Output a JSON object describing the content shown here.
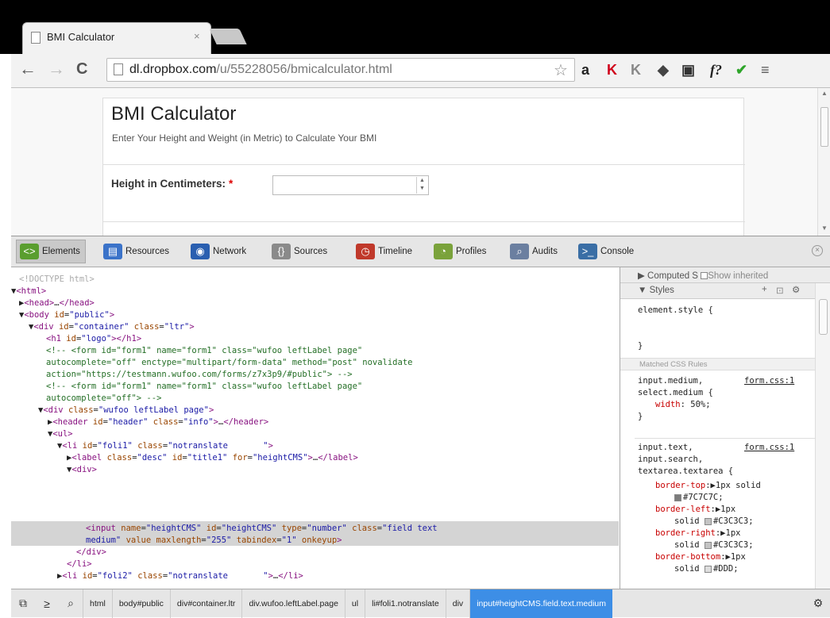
{
  "browser": {
    "tab_title": "BMI Calculator",
    "tab_close": "×",
    "url_host": "dl.dropbox.com",
    "url_path": "/u/55228056/bmicalculator.html",
    "nav": {
      "back": "←",
      "forward": "→",
      "reload": "C"
    },
    "extensions": [
      {
        "name": "amazon-icon",
        "glyph": "a",
        "color": "#222"
      },
      {
        "name": "pdf-icon",
        "glyph": "K",
        "color": "#d0021b"
      },
      {
        "name": "extension-k-icon",
        "glyph": "K",
        "color": "#888"
      },
      {
        "name": "pocket-icon",
        "glyph": "◆",
        "color": "#444"
      },
      {
        "name": "evernote-icon",
        "glyph": "▣",
        "color": "#333"
      },
      {
        "name": "formula-icon",
        "glyph": "f?",
        "color": "#222"
      },
      {
        "name": "check-icon",
        "glyph": "✔",
        "color": "#2ea52a"
      },
      {
        "name": "menu-icon",
        "glyph": "≡",
        "color": "#555"
      }
    ]
  },
  "page": {
    "title": "BMI Calculator",
    "description": "Enter Your Height and Weight (in Metric) to Calculate Your BMI",
    "height_label": "Height in Centimeters:",
    "required_mark": "*",
    "height_value": ""
  },
  "devtools": {
    "tabs": [
      {
        "label": "Elements",
        "icon": "elements-icon",
        "color": "#5a9e2f",
        "glyph": "<>"
      },
      {
        "label": "Resources",
        "icon": "resources-icon",
        "color": "#3b73c9",
        "glyph": "▤"
      },
      {
        "label": "Network",
        "icon": "network-icon",
        "color": "#2a5fb0",
        "glyph": "◉"
      },
      {
        "label": "Sources",
        "icon": "sources-icon",
        "color": "#8a8a8a",
        "glyph": "{}"
      },
      {
        "label": "Timeline",
        "icon": "timeline-icon",
        "color": "#c0392b",
        "glyph": "◷"
      },
      {
        "label": "Profiles",
        "icon": "profiles-icon",
        "color": "#7aa23b",
        "glyph": "◔"
      },
      {
        "label": "Audits",
        "icon": "audits-icon",
        "color": "#6b7fa0",
        "glyph": "⌕"
      },
      {
        "label": "Console",
        "icon": "console-icon",
        "color": "#3a6ea5",
        "glyph": ">_"
      }
    ],
    "sidebar": {
      "computed_label": "Computed S",
      "show_inherited": "Show inherited",
      "styles_label": "Styles",
      "element_style": "element.style {",
      "close_brace": "}",
      "matched_header": "Matched CSS Rules",
      "rule1_selector_a": "input.medium,",
      "rule1_selector_b": "select.medium {",
      "rule1_source": "form.css:1",
      "rule1_prop": "width",
      "rule1_value": "50%;",
      "rule2_selector_a": "input.text,",
      "rule2_selector_b": "input.search,",
      "rule2_selector_c": "textarea.textarea {",
      "rule2_source": "form.css:1",
      "props": [
        {
          "name": "border-top",
          "v1": "1px solid",
          "v2": "#7C7C7C;",
          "swatch": "#7C7C7C"
        },
        {
          "name": "border-left",
          "v1": "1px",
          "v2": "solid",
          "v3": "#C3C3C3;",
          "swatch": "#C3C3C3"
        },
        {
          "name": "border-right",
          "v1": "1px",
          "v2": "solid",
          "v3": "#C3C3C3;",
          "swatch": "#C3C3C3"
        },
        {
          "name": "border-bottom",
          "v1": "1px",
          "v2": "solid",
          "v3": "#DDD;",
          "swatch": "#DDDDDD"
        }
      ]
    },
    "breadcrumbs": [
      "html",
      "body#public",
      "div#container.ltr",
      "div.wufoo.leftLabel.page",
      "ul",
      "li#foli1.notranslate",
      "div",
      "input#heightCMS.field.text.medium"
    ]
  }
}
